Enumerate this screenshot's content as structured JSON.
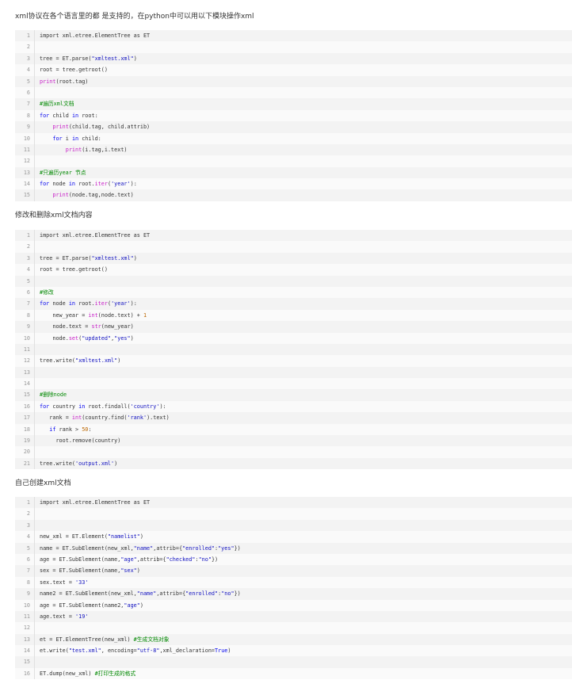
{
  "paragraphs": [
    "xml协议在各个语言里的都 是支持的，在python中可以用以下模块操作xml",
    "修改和删除xml文档内容",
    "自己创建xml文档"
  ],
  "code_blocks": [
    {
      "lines": [
        [
          [
            "n",
            "import xml.etree.ElementTree as ET"
          ]
        ],
        [],
        [
          [
            "n",
            "tree = ET.parse("
          ],
          [
            "str",
            "\"xmltest.xml\""
          ],
          [
            "n",
            ")"
          ]
        ],
        [
          [
            "n",
            "root = tree.getroot()"
          ]
        ],
        [
          [
            "bi",
            "print"
          ],
          [
            "n",
            "(root.tag)"
          ]
        ],
        [],
        [
          [
            "cm",
            "#遍历xml文档"
          ]
        ],
        [
          [
            "kw",
            "for"
          ],
          [
            "n",
            " child "
          ],
          [
            "kw",
            "in"
          ],
          [
            "n",
            " root:"
          ]
        ],
        [
          [
            "n",
            "    "
          ],
          [
            "bi",
            "print"
          ],
          [
            "n",
            "(child.tag, child.attrib)"
          ]
        ],
        [
          [
            "n",
            "    "
          ],
          [
            "kw",
            "for"
          ],
          [
            "n",
            " i "
          ],
          [
            "kw",
            "in"
          ],
          [
            "n",
            " child:"
          ]
        ],
        [
          [
            "n",
            "        "
          ],
          [
            "bi",
            "print"
          ],
          [
            "n",
            "(i.tag,i.text)"
          ]
        ],
        [],
        [
          [
            "cm",
            "#只遍历year 节点"
          ]
        ],
        [
          [
            "kw",
            "for"
          ],
          [
            "n",
            " node "
          ],
          [
            "kw",
            "in"
          ],
          [
            "n",
            " root."
          ],
          [
            "bi",
            "iter"
          ],
          [
            "n",
            "("
          ],
          [
            "str",
            "'year'"
          ],
          [
            "n",
            "):"
          ]
        ],
        [
          [
            "n",
            "    "
          ],
          [
            "bi",
            "print"
          ],
          [
            "n",
            "(node.tag,node.text)"
          ]
        ]
      ]
    },
    {
      "lines": [
        [
          [
            "n",
            "import xml.etree.ElementTree as ET"
          ]
        ],
        [],
        [
          [
            "n",
            "tree = ET.parse("
          ],
          [
            "str",
            "\"xmltest.xml\""
          ],
          [
            "n",
            ")"
          ]
        ],
        [
          [
            "n",
            "root = tree.getroot()"
          ]
        ],
        [],
        [
          [
            "cm",
            "#修改"
          ]
        ],
        [
          [
            "kw",
            "for"
          ],
          [
            "n",
            " node "
          ],
          [
            "kw",
            "in"
          ],
          [
            "n",
            " root."
          ],
          [
            "bi",
            "iter"
          ],
          [
            "n",
            "("
          ],
          [
            "str",
            "'year'"
          ],
          [
            "n",
            "):"
          ]
        ],
        [
          [
            "n",
            "    new_year = "
          ],
          [
            "bi",
            "int"
          ],
          [
            "n",
            "(node.text) + "
          ],
          [
            "num",
            "1"
          ]
        ],
        [
          [
            "n",
            "    node.text = "
          ],
          [
            "bi",
            "str"
          ],
          [
            "n",
            "(new_year)"
          ]
        ],
        [
          [
            "n",
            "    node."
          ],
          [
            "bi",
            "set"
          ],
          [
            "n",
            "("
          ],
          [
            "str",
            "\"updated\""
          ],
          [
            "n",
            ","
          ],
          [
            "str",
            "\"yes\""
          ],
          [
            "n",
            ")"
          ]
        ],
        [],
        [
          [
            "n",
            "tree.write("
          ],
          [
            "str",
            "\"xmltest.xml\""
          ],
          [
            "n",
            ")"
          ]
        ],
        [],
        [],
        [
          [
            "cm",
            "#删除node"
          ]
        ],
        [
          [
            "kw",
            "for"
          ],
          [
            "n",
            " country "
          ],
          [
            "kw",
            "in"
          ],
          [
            "n",
            " root.findall("
          ],
          [
            "str",
            "'country'"
          ],
          [
            "n",
            "):"
          ]
        ],
        [
          [
            "n",
            "   rank = "
          ],
          [
            "bi",
            "int"
          ],
          [
            "n",
            "(country.find("
          ],
          [
            "str",
            "'rank'"
          ],
          [
            "n",
            ").text)"
          ]
        ],
        [
          [
            "n",
            "   "
          ],
          [
            "kw",
            "if"
          ],
          [
            "n",
            " rank > "
          ],
          [
            "num",
            "50"
          ],
          [
            "n",
            ":"
          ]
        ],
        [
          [
            "n",
            "     root.remove(country)"
          ]
        ],
        [],
        [
          [
            "n",
            "tree.write("
          ],
          [
            "str",
            "'output.xml'"
          ],
          [
            "n",
            ")"
          ]
        ]
      ]
    },
    {
      "lines": [
        [
          [
            "n",
            "import xml.etree.ElementTree as ET"
          ]
        ],
        [],
        [],
        [
          [
            "n",
            "new_xml = ET.Element("
          ],
          [
            "str",
            "\"namelist\""
          ],
          [
            "n",
            ")"
          ]
        ],
        [
          [
            "n",
            "name = ET.SubElement(new_xml,"
          ],
          [
            "str",
            "\"name\""
          ],
          [
            "n",
            ",attrib={"
          ],
          [
            "str",
            "\"enrolled\""
          ],
          [
            "n",
            ":"
          ],
          [
            "str",
            "\"yes\""
          ],
          [
            "n",
            "})"
          ]
        ],
        [
          [
            "n",
            "age = ET.SubElement(name,"
          ],
          [
            "str",
            "\"age\""
          ],
          [
            "n",
            ",attrib={"
          ],
          [
            "str",
            "\"checked\""
          ],
          [
            "n",
            ":"
          ],
          [
            "str",
            "\"no\""
          ],
          [
            "n",
            "})"
          ]
        ],
        [
          [
            "n",
            "sex = ET.SubElement(name,"
          ],
          [
            "str",
            "\"sex\""
          ],
          [
            "n",
            ")"
          ]
        ],
        [
          [
            "n",
            "sex.text = "
          ],
          [
            "str",
            "'33'"
          ]
        ],
        [
          [
            "n",
            "name2 = ET.SubElement(new_xml,"
          ],
          [
            "str",
            "\"name\""
          ],
          [
            "n",
            ",attrib={"
          ],
          [
            "str",
            "\"enrolled\""
          ],
          [
            "n",
            ":"
          ],
          [
            "str",
            "\"no\""
          ],
          [
            "n",
            "})"
          ]
        ],
        [
          [
            "n",
            "age = ET.SubElement(name2,"
          ],
          [
            "str",
            "\"age\""
          ],
          [
            "n",
            ")"
          ]
        ],
        [
          [
            "n",
            "age.text = "
          ],
          [
            "str",
            "'19'"
          ]
        ],
        [],
        [
          [
            "n",
            "et = ET.ElementTree(new_xml) "
          ],
          [
            "cm",
            "#生成文档对象"
          ]
        ],
        [
          [
            "n",
            "et.write("
          ],
          [
            "str",
            "\"test.xml\""
          ],
          [
            "n",
            ", encoding="
          ],
          [
            "str",
            "\"utf-8\""
          ],
          [
            "n",
            ",xml_declaration="
          ],
          [
            "bool",
            "True"
          ],
          [
            "n",
            ")"
          ]
        ],
        [],
        [
          [
            "n",
            "ET.dump(new_xml) "
          ],
          [
            "cm",
            "#打印生成的格式"
          ]
        ]
      ]
    }
  ]
}
